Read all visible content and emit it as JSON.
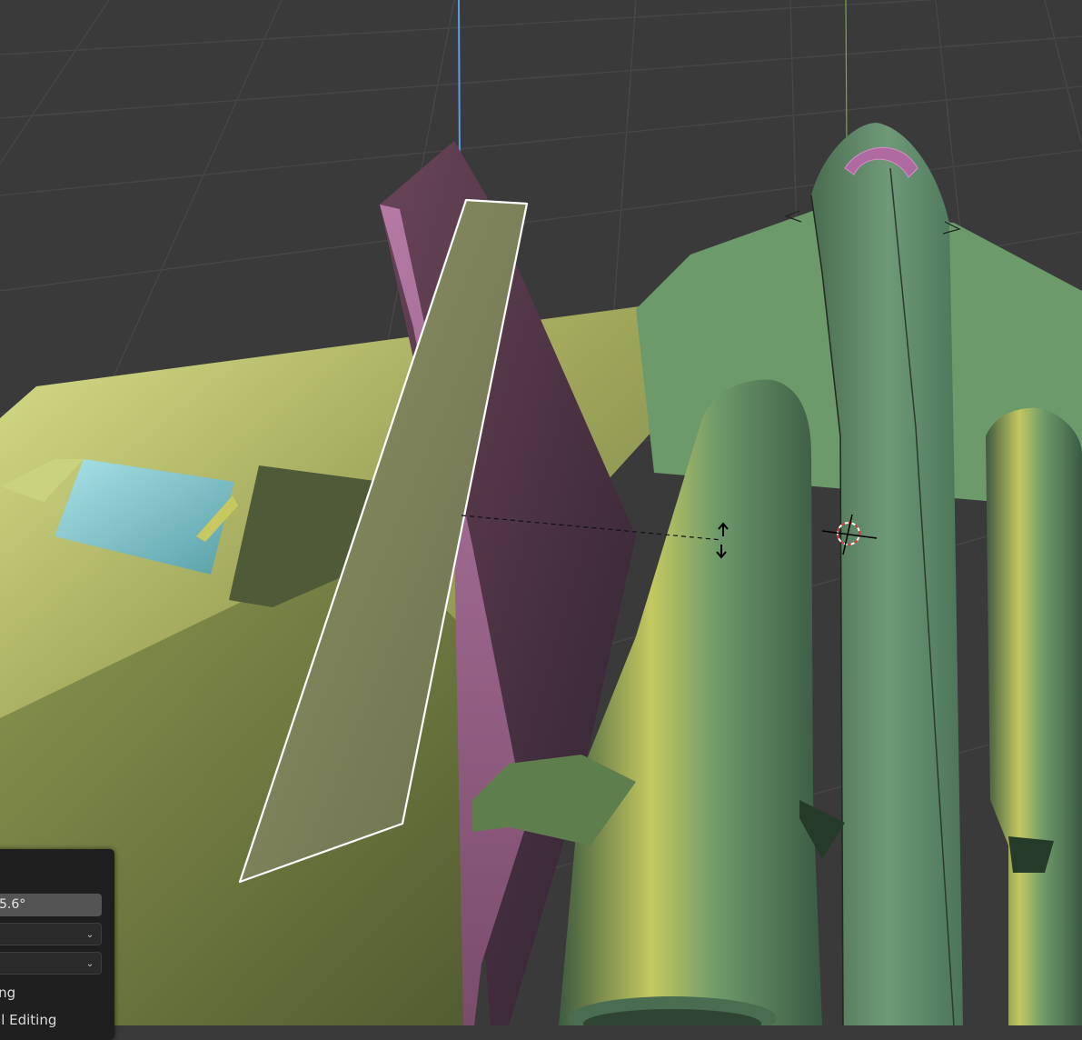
{
  "viewport": {
    "colors": {
      "background": "#3a3a3a",
      "grid": "#474747",
      "axis_z": "#5e9ee6",
      "axis_y": "#7fa644",
      "selection_outline": "#ffffff",
      "wing_green": "#8a9a52",
      "flap_cyan": "#7ec6cc",
      "fin_mauve": "#5e3a4c",
      "body_green": "#5e8a6c",
      "canopy_pink": "#b06aa2"
    }
  },
  "operator_panel": {
    "angle_value": "5.6°",
    "dropdown_1_value": "",
    "dropdown_2_value": "",
    "option_1_label": "ing",
    "option_2_label": "al Editing"
  }
}
